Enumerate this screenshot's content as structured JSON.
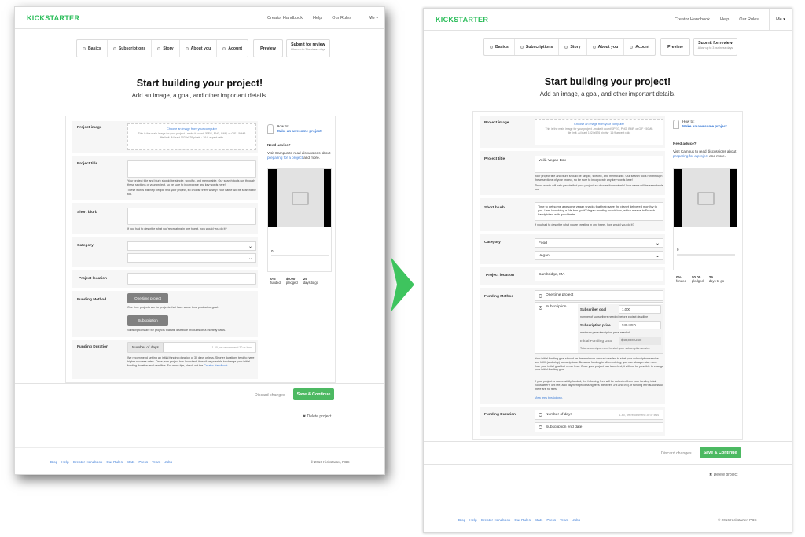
{
  "brand": {
    "logo": "KICKSTARTER",
    "accent": "#2bbd5a",
    "save_color": "#4cb962",
    "arrow_color": "#3ec45e"
  },
  "nav": {
    "links": [
      "Creator Handbook",
      "Help",
      "Our Rules"
    ],
    "me": "Me ▾"
  },
  "tabs": [
    "Basics",
    "Subscriptions",
    "Story",
    "About you",
    "Acount"
  ],
  "preview_label": "Preview",
  "submit": {
    "title": "Submit for review",
    "sub": "Allow up to 3 business days"
  },
  "hero": {
    "title": "Start building your project!",
    "subtitle": "Add an image, a goal, and other important details."
  },
  "fields": {
    "project_image": {
      "label": "Project image",
      "link": "Choose an image from your computer",
      "desc": "This is the main image for your project - make it count! JPEG, PNG, BMP, or GIF · 50MB file limit. At least 1024x576 pixels · 16:9 aspect ratio"
    },
    "project_title": {
      "label": "Project title",
      "help": "Your project title and blurb should be simple, specific, and memorable. Our search tools run through these sections of your project, so be sure to incorporate any key words here!",
      "help2": "These words will help people find your project, so choose them wisely! Your name will be searchable too."
    },
    "short_blurb": {
      "label": "Short blurb",
      "help": "If you had to describe what you're creating in one tweet, how would you do it?"
    },
    "category": {
      "label": "Category"
    },
    "project_location": {
      "label": "Project location"
    },
    "funding_method": {
      "label": "Funding Method",
      "one_time_btn": "One time project",
      "one_time_help": "One time projects are for projects that have a one time product or goal.",
      "subscription_btn": "Subscription",
      "subscription_help": "Subscriptions are for projects that will distribute products on a monthly basis."
    },
    "funding_duration": {
      "label": "Funding Duration",
      "option": "Number of days",
      "hint": "1-60, we recommend 30 or less",
      "help": "We recommend setting an initial funding duration of 30 days or less. Shorter durations tend to have higher success rates. Once your project has launched, it won't be possible to change your initial funding duration and deadline. For more tips, check out the",
      "help_link": "Creator Handbook."
    }
  },
  "right_values": {
    "project_title": "Voilà Vegan Box",
    "short_blurb": "Time to get some awesome vegan snacks that help save the planet delivered monthly to you. I am launching a \"de bon goût\" Vegan monthly snack box, which means in French handpicked with good taste.",
    "category": "Food",
    "subcategory": "Vegan",
    "project_location": "Cambridge, MA",
    "funding_one_time": "One time project",
    "funding_subscription": "Subscription",
    "subscriber_goal_label": "Subscriber goal",
    "subscriber_goal": "1,000",
    "subscriber_goal_help": "number of subscribers needed before project deadline",
    "subscription_price_label": "Subscription price",
    "subscription_price": "$40 USD",
    "subscription_price_help": "minimum per subscription price needed",
    "initial_goal_label": "Initial Funding Goal",
    "initial_goal": "$40,000 USD",
    "initial_goal_help": "Total amount you need to start your subscription service",
    "goal_note1": "Your initial funding goal should be the minimum amount needed to start your subscription service and fulfill (and ship) subscriptions. Because funding is all-or-nothing, you can always raise more than your initial goal but never less. Once your project has launched, it will not be possible to change your initial funding goal.",
    "goal_note2": "If your project is successfully funded, the following fees will be collected from your funding total: Kickstarter's 5% fee, and payment processing fees (between 3% and 5%). If funding isn't successful, there are no fees.",
    "fees_link": "View fees breakdown.",
    "duration_days": "Number of days",
    "duration_hint": "1-60, we recommend 30 or less",
    "duration_end": "Subscription end date"
  },
  "sidebar": {
    "howto_small": "How to:",
    "howto_link": "Make an awesome project",
    "advice_title": "Need advice?",
    "advice_text": "Visit Campus to read discussions about",
    "advice_link": "preparing for a project",
    "advice_tail": "and more.",
    "stat_count": "0",
    "funded_pct": "0%",
    "funded_lbl": "funded",
    "pledged": "$0.00",
    "pledged_lbl": "pledged",
    "days": "29",
    "days_lbl": "days to go"
  },
  "actions": {
    "discard": "Discard changes",
    "save": "Save & Continue",
    "delete": "Delete project"
  },
  "footer": {
    "links": [
      "Blog",
      "Help",
      "Creator Handbook",
      "Our Rules",
      "Stats",
      "Press",
      "Team",
      "Jobs"
    ],
    "copyright": "© 2016 Kickstarter, PBC"
  }
}
